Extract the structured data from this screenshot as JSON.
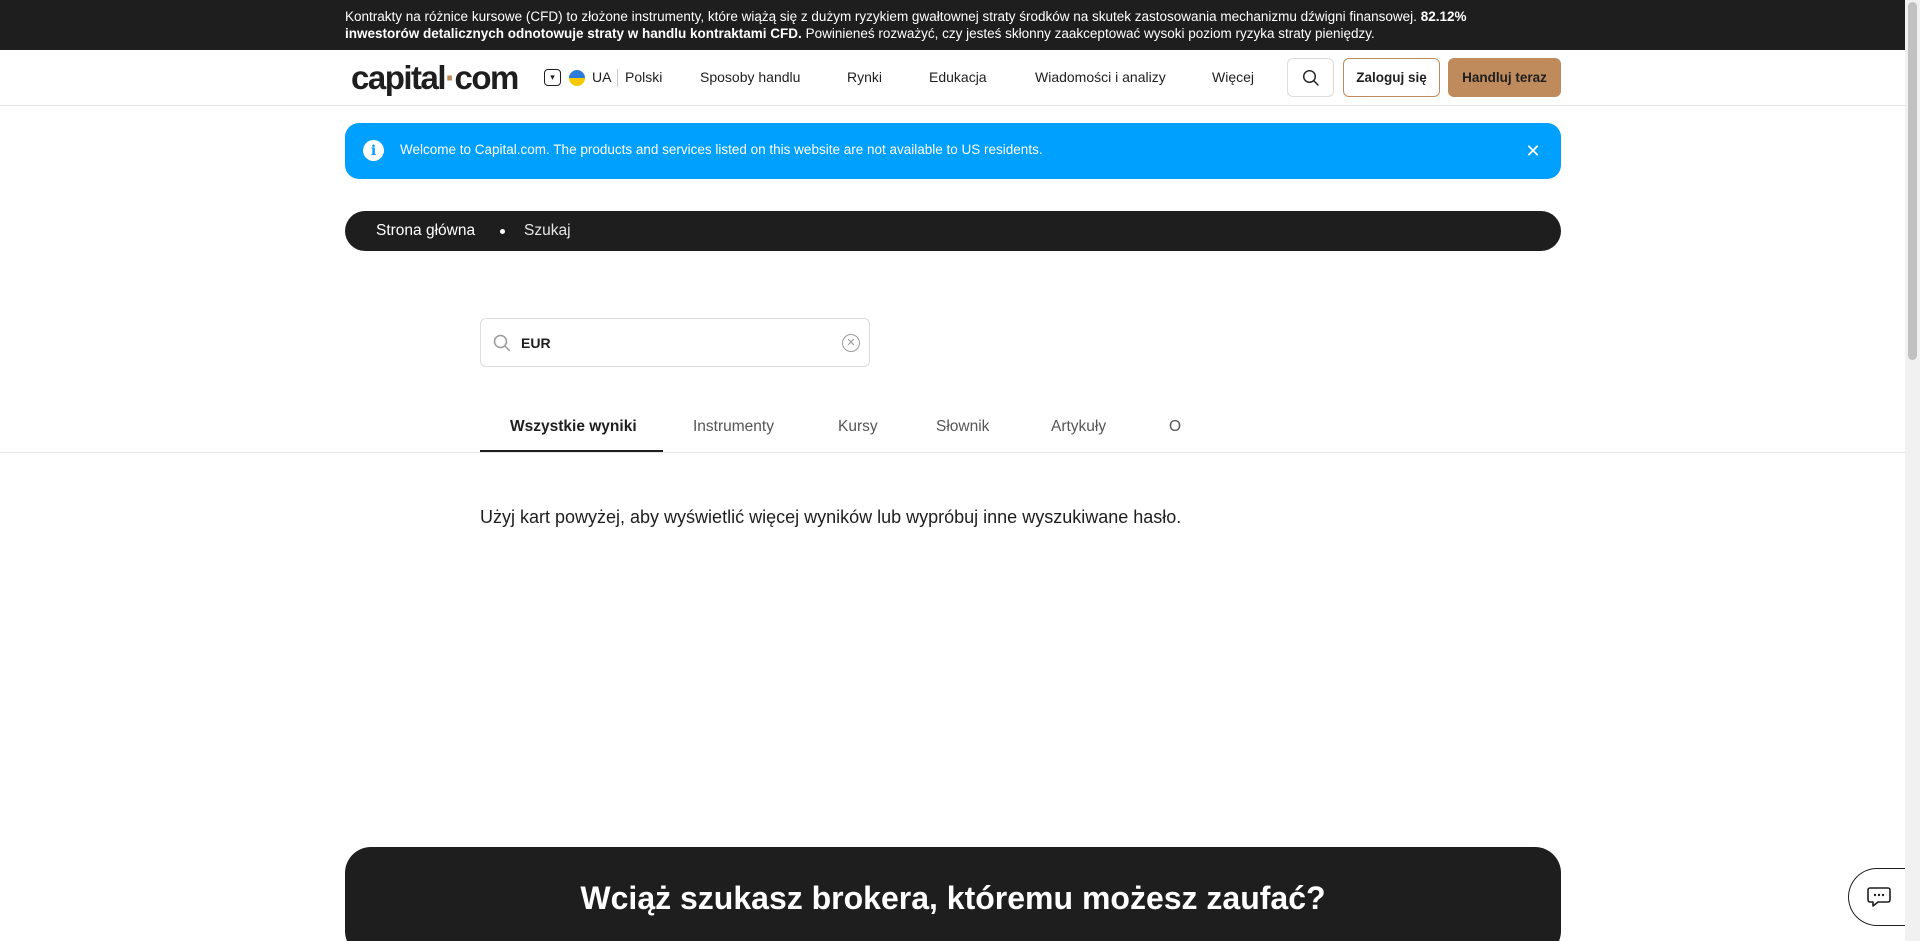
{
  "risk_banner": {
    "text_part1": "Kontrakty na różnice kursowe (CFD) to złożone instrumenty, które wiążą się z dużym ryzykiem gwałtownej straty środków na skutek zastosowania mechanizmu dźwigni finansowej. ",
    "text_bold": "82.12% inwestorów detalicznych odnotowuje straty w handlu kontraktami CFD.",
    "text_part2": " Powinieneś rozważyć, czy jesteś skłonny zaakceptować wysoki poziom ryzyka straty pieniędzy."
  },
  "header": {
    "logo_part1": "capital",
    "logo_dot": "·",
    "logo_part2": "com",
    "region": "UA",
    "language": "Polski",
    "nav": [
      "Sposoby handlu",
      "Rynki",
      "Edukacja",
      "Wiadomości i analizy",
      "Więcej"
    ],
    "login_label": "Zaloguj się",
    "trade_label": "Handluj teraz"
  },
  "notice": {
    "text": "Welcome to Capital.com. The products and services listed on this website are not available to US residents."
  },
  "breadcrumb": {
    "home": "Strona główna",
    "current": "Szukaj"
  },
  "search": {
    "value": "EUR"
  },
  "tabs": [
    "Wszystkie wyniki",
    "Instrumenty",
    "Kursy",
    "Słownik",
    "Artykuły",
    "O"
  ],
  "active_tab": "Wszystkie wyniki",
  "info_text": "Użyj kart powyżej, aby wyświetlić więcej wyników lub wypróbuj inne wyszukiwane hasło.",
  "cta": {
    "title": "Wciąż szukasz brokera, któremu możesz zaufać?"
  },
  "colors": {
    "dark": "#1e1e1e",
    "accent": "#c08b5c",
    "info_blue": "#00a0ff"
  }
}
